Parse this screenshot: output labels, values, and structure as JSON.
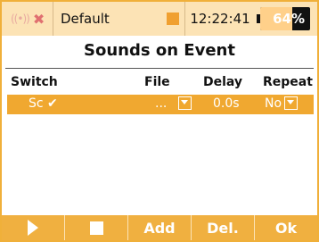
{
  "status": {
    "model_name": "Default",
    "time": "12:22:41",
    "battery_text": "64%",
    "battery_level": 0.64,
    "icons": [
      "radio-signal-icon",
      "close-icon",
      "status-square-icon"
    ]
  },
  "title": "Sounds on Event",
  "table": {
    "headers": [
      "Switch",
      "File",
      "Delay",
      "Repeat"
    ],
    "rows": [
      {
        "switch": "Sc ✔",
        "file": "...",
        "delay": "0.0s",
        "repeat": "No"
      }
    ]
  },
  "buttons": {
    "add": "Add",
    "delete": "Del.",
    "ok": "Ok"
  },
  "colors": {
    "accent": "#f0a830",
    "statusbar": "#fce3b5",
    "border": "#f0b03a"
  }
}
